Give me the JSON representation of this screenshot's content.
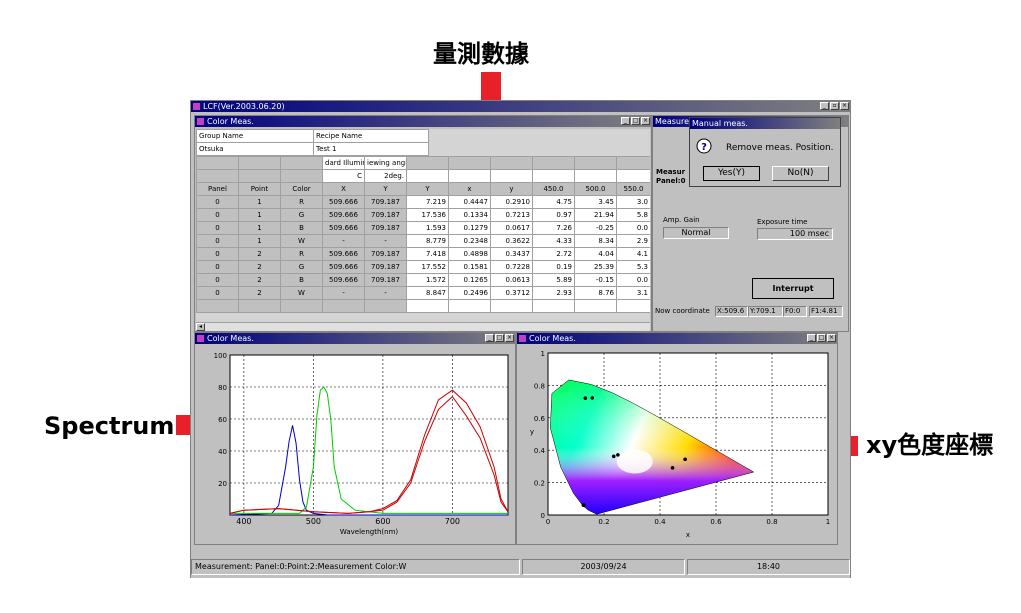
{
  "annotations": {
    "top": "量測數據",
    "left": "Spectrum",
    "right": "xy色度座標"
  },
  "app": {
    "title": "LCF(Ver.2003.06.20)",
    "colorMeasTitle": "Color Meas.",
    "measurementTitle": "Measurem",
    "status": {
      "left": "Measurement: Panel:0:Point:2:Measurement Color:W",
      "date": "2003/09/24",
      "time": "18:40"
    }
  },
  "table": {
    "groupNameLabel": "Group Name",
    "recipeNameLabel": "Recipe Name",
    "groupNameValue": "Otsuka",
    "recipeNameValue": "Test 1",
    "illuminantLabel": "dard Illumir",
    "illuminantValue": "C",
    "viewingLabel": "iewing angl",
    "viewingValue": "2deg.",
    "headers": [
      "Panel",
      "Point",
      "Color",
      "X",
      "Y",
      "Y",
      "x",
      "y",
      "450.0",
      "500.0",
      "550.0"
    ],
    "rows": [
      [
        "0",
        "1",
        "R",
        "509.666",
        "709.187",
        "7.219",
        "0.4447",
        "0.2910",
        "4.75",
        "3.45",
        "3.0"
      ],
      [
        "0",
        "1",
        "G",
        "509.666",
        "709.187",
        "17.536",
        "0.1334",
        "0.7213",
        "0.97",
        "21.94",
        "5.8"
      ],
      [
        "0",
        "1",
        "B",
        "509.666",
        "709.187",
        "1.593",
        "0.1279",
        "0.0617",
        "7.26",
        "-0.25",
        "0.0"
      ],
      [
        "0",
        "1",
        "W",
        "-",
        "-",
        "8.779",
        "0.2348",
        "0.3622",
        "4.33",
        "8.34",
        "2.9"
      ],
      [
        "0",
        "2",
        "R",
        "509.666",
        "709.187",
        "7.418",
        "0.4898",
        "0.3437",
        "2.72",
        "4.04",
        "4.1"
      ],
      [
        "0",
        "2",
        "G",
        "509.666",
        "709.187",
        "17.552",
        "0.1581",
        "0.7228",
        "0.19",
        "25.39",
        "5.3"
      ],
      [
        "0",
        "2",
        "B",
        "509.666",
        "709.187",
        "1.572",
        "0.1265",
        "0.0613",
        "5.89",
        "-0.15",
        "0.0"
      ],
      [
        "0",
        "2",
        "W",
        "-",
        "-",
        "8.847",
        "0.2496",
        "0.3712",
        "2.93",
        "8.76",
        "3.1"
      ]
    ]
  },
  "dialog": {
    "title": "Manual meas.",
    "message": "Remove meas. Position.",
    "yes": "Yes(Y)",
    "no": "No(N)"
  },
  "measurePanel": {
    "measureLabel": "Measur",
    "panelLabel": "Panel:0",
    "ampGainLabel": "Amp. Gain",
    "ampGainValue": "Normal",
    "exposureLabel": "Exposure time",
    "exposureValue": "100 msec",
    "interrupt": "Interrupt",
    "nowCoordLabel": "Now coordinate",
    "coordX": "X:509.6",
    "coordY": "Y:709.1",
    "coordF0": "F0:0",
    "coordF1": "F1:4.81"
  },
  "chart_data": [
    {
      "type": "line",
      "xlabel": "Wavelength(nm)",
      "ylabel": "",
      "xlim": [
        380,
        780
      ],
      "ylim": [
        0,
        100
      ],
      "xticks": [
        "400",
        "500",
        "600",
        "700"
      ],
      "yticks": [
        "100",
        "80",
        "60",
        "40",
        "20"
      ],
      "grid": true,
      "series": [
        {
          "color": "#0000cc",
          "x": [
            380,
            440,
            450,
            460,
            465,
            470,
            475,
            480,
            485,
            490,
            500,
            520,
            560,
            600,
            700,
            780
          ],
          "y": [
            0,
            1,
            6,
            30,
            46,
            56,
            45,
            22,
            8,
            3,
            1,
            0,
            0,
            0,
            0,
            0
          ]
        },
        {
          "color": "#00cc00",
          "x": [
            380,
            480,
            490,
            500,
            505,
            510,
            515,
            520,
            525,
            530,
            540,
            560,
            600,
            700,
            780
          ],
          "y": [
            1,
            1,
            5,
            30,
            62,
            78,
            80,
            76,
            60,
            30,
            10,
            3,
            1,
            1,
            1
          ]
        },
        {
          "color": "#cc0000",
          "x": [
            380,
            400,
            450,
            500,
            550,
            580,
            600,
            620,
            640,
            660,
            680,
            700,
            720,
            740,
            760,
            770,
            780
          ],
          "y": [
            1,
            3,
            4,
            2,
            1,
            2,
            4,
            9,
            22,
            50,
            72,
            78,
            70,
            55,
            30,
            10,
            2
          ]
        },
        {
          "color": "#cc0000",
          "x": [
            380,
            400,
            450,
            500,
            550,
            580,
            600,
            620,
            640,
            660,
            680,
            700,
            720,
            740,
            760,
            770,
            780
          ],
          "y": [
            1,
            3,
            4,
            2,
            1,
            2,
            3,
            8,
            20,
            46,
            66,
            74,
            62,
            48,
            25,
            8,
            2
          ]
        }
      ]
    },
    {
      "type": "scatter",
      "xlabel": "x",
      "ylabel": "y",
      "xlim": [
        0,
        1
      ],
      "ylim": [
        0,
        1
      ],
      "xticks": [
        "0",
        "0.2",
        "0.4",
        "0.6",
        "0.8",
        "1"
      ],
      "yticks": [
        "0",
        "0.2",
        "0.4",
        "0.6",
        "0.8",
        "1"
      ],
      "grid": true,
      "points": [
        [
          0.1334,
          0.7213
        ],
        [
          0.1581,
          0.7228
        ],
        [
          0.2348,
          0.3622
        ],
        [
          0.2496,
          0.3712
        ],
        [
          0.4447,
          0.291
        ],
        [
          0.4898,
          0.3437
        ],
        [
          0.1279,
          0.0617
        ],
        [
          0.1265,
          0.0613
        ]
      ],
      "locus": [
        [
          0.1741,
          0.005
        ],
        [
          0.144,
          0.0297
        ],
        [
          0.1241,
          0.0578
        ],
        [
          0.0913,
          0.1327
        ],
        [
          0.0454,
          0.295
        ],
        [
          0.0082,
          0.5384
        ],
        [
          0.0139,
          0.7502
        ],
        [
          0.0743,
          0.8338
        ],
        [
          0.1547,
          0.8059
        ],
        [
          0.2296,
          0.7543
        ],
        [
          0.3016,
          0.6923
        ],
        [
          0.3731,
          0.6245
        ],
        [
          0.4441,
          0.5547
        ],
        [
          0.5125,
          0.4866
        ],
        [
          0.5752,
          0.4242
        ],
        [
          0.627,
          0.3725
        ],
        [
          0.6658,
          0.334
        ],
        [
          0.6915,
          0.3083
        ],
        [
          0.7347,
          0.2653
        ],
        [
          0.1741,
          0.005
        ]
      ]
    }
  ]
}
